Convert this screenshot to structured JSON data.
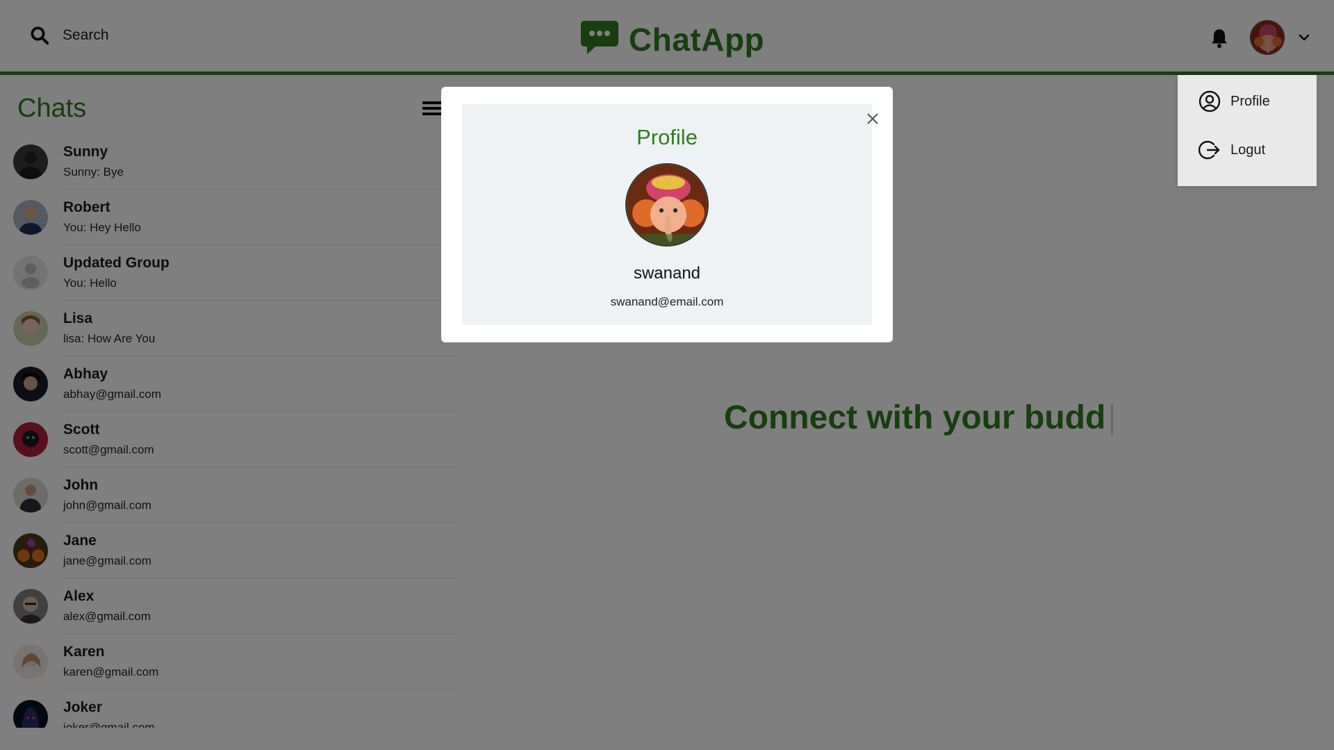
{
  "header": {
    "search_label": "Search",
    "brand_title": "ChatApp",
    "colors": {
      "brand": "#2e7d1f"
    }
  },
  "sidebar": {
    "title": "Chats",
    "chats": [
      {
        "name": "Sunny",
        "preview": "Sunny: Bye",
        "avatar": "#3a3a3a"
      },
      {
        "name": "Robert",
        "preview": "You: Hey Hello",
        "avatar": "#4a5a7a"
      },
      {
        "name": "Updated Group",
        "preview": "You: Hello",
        "avatar": "#d8d8d8"
      },
      {
        "name": "Lisa",
        "preview": "lisa: How Are You",
        "avatar": "#d9b39a"
      },
      {
        "name": "Abhay",
        "preview": "abhay@gmail.com",
        "avatar": "#2a2a3a"
      },
      {
        "name": "Scott",
        "preview": "scott@gmail.com",
        "avatar": "#b0203a"
      },
      {
        "name": "John",
        "preview": "john@gmail.com",
        "avatar": "#6a6a5a"
      },
      {
        "name": "Jane",
        "preview": "jane@gmail.com",
        "avatar": "#8a4a1a"
      },
      {
        "name": "Alex",
        "preview": "alex@gmail.com",
        "avatar": "#5a5050"
      },
      {
        "name": "Karen",
        "preview": "karen@gmail.com",
        "avatar": "#e0c8c0"
      },
      {
        "name": "Joker",
        "preview": "joker@gmail.com",
        "avatar": "#101830"
      }
    ]
  },
  "main": {
    "welcome_text": "Connect with your budd"
  },
  "dropdown": {
    "profile_label": "Profile",
    "logout_label": "Logut"
  },
  "modal": {
    "title": "Profile",
    "name": "swanand",
    "email": "swanand@email.com"
  }
}
